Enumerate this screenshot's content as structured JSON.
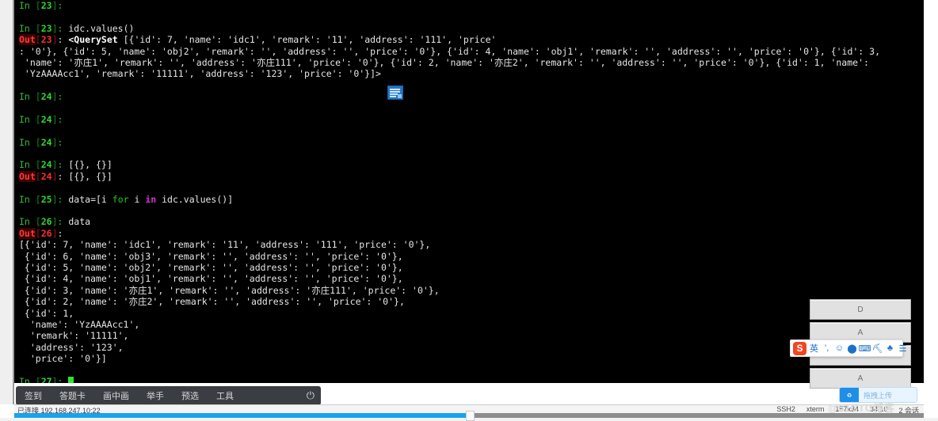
{
  "terminal": {
    "lines": [
      {
        "type": "prompt_only",
        "label": "In",
        "num": "23",
        "code": ""
      },
      {
        "type": "blank"
      },
      {
        "type": "input",
        "label": "In",
        "num": "23",
        "code": "idc.values()"
      },
      {
        "type": "output_head",
        "label": "Out",
        "num": "23",
        "code": "<QuerySet [{'id': 7, 'name': 'idc1', 'remark': '11', 'address': '111', 'price'"
      },
      {
        "type": "plain",
        "code": ": '0'}, {'id': 5, 'name': 'obj2', 'remark': '', 'address': '', 'price': '0'}, {'id': 4, 'name': 'obj1', 'remark': '', 'address': '', 'price': '0'}, {'id': 3,"
      },
      {
        "type": "plain",
        "code": " 'name': '亦庄1', 'remark': '', 'address': '亦庄111', 'price': '0'}, {'id': 2, 'name': '亦庄2', 'remark': '', 'address': '', 'price': '0'}, {'id': 1, 'name':"
      },
      {
        "type": "plain",
        "code": " 'YzAAAAcc1', 'remark': '11111', 'address': '123', 'price': '0'}]>"
      },
      {
        "type": "blank"
      },
      {
        "type": "input",
        "label": "In",
        "num": "24",
        "code": ""
      },
      {
        "type": "blank"
      },
      {
        "type": "input",
        "label": "In",
        "num": "24",
        "code": ""
      },
      {
        "type": "blank"
      },
      {
        "type": "input",
        "label": "In",
        "num": "24",
        "code": ""
      },
      {
        "type": "blank"
      },
      {
        "type": "input",
        "label": "In",
        "num": "24",
        "code": "[{}, {}]"
      },
      {
        "type": "output",
        "label": "Out",
        "num": "24",
        "code": "[{}, {}]"
      },
      {
        "type": "blank"
      },
      {
        "type": "input_kw",
        "label": "In",
        "num": "25",
        "code": "data=[i for i in idc.values()]"
      },
      {
        "type": "blank"
      },
      {
        "type": "input",
        "label": "In",
        "num": "26",
        "code": "data"
      },
      {
        "type": "output_only",
        "label": "Out",
        "num": "26",
        "code": ""
      },
      {
        "type": "plain",
        "code": "[{'id': 7, 'name': 'idc1', 'remark': '11', 'address': '111', 'price': '0'},"
      },
      {
        "type": "plain",
        "code": " {'id': 6, 'name': 'obj3', 'remark': '', 'address': '', 'price': '0'},"
      },
      {
        "type": "plain",
        "code": " {'id': 5, 'name': 'obj2', 'remark': '', 'address': '', 'price': '0'},"
      },
      {
        "type": "plain",
        "code": " {'id': 4, 'name': 'obj1', 'remark': '', 'address': '', 'price': '0'},"
      },
      {
        "type": "plain",
        "code": " {'id': 3, 'name': '亦庄1', 'remark': '', 'address': '亦庄111', 'price': '0'},"
      },
      {
        "type": "plain",
        "code": " {'id': 2, 'name': '亦庄2', 'remark': '', 'address': '', 'price': '0'},"
      },
      {
        "type": "plain",
        "code": " {'id': 1,"
      },
      {
        "type": "plain",
        "code": "  'name': 'YzAAAAcc1',"
      },
      {
        "type": "plain",
        "code": "  'remark': '11111',"
      },
      {
        "type": "plain",
        "code": "  'address': '123',"
      },
      {
        "type": "plain",
        "code": "  'price': '0'}]"
      },
      {
        "type": "blank"
      },
      {
        "type": "cursor",
        "label": "In",
        "num": "27",
        "code": ""
      }
    ],
    "syntax_keywords": [
      "for",
      "in"
    ],
    "colors": {
      "background": "#000000",
      "in_prompt": "#2fd72f",
      "out_prompt": "#ff2d2d",
      "text": "#dcdcdc",
      "keyword_for": "#1ecb1e",
      "keyword_in": "#d42fd4"
    }
  },
  "clipboard_icon": {
    "name": "clipboard-paste-icon"
  },
  "side_buttons": [
    {
      "label": "D",
      "name": "side-button-d"
    },
    {
      "label": "A",
      "name": "side-button-a-1"
    },
    {
      "label": "A",
      "name": "side-button-a-2"
    },
    {
      "label": "A",
      "name": "side-button-a-3"
    }
  ],
  "ime_bar": {
    "logo": "S",
    "items": [
      {
        "glyph": "英",
        "name": "ime-language-toggle"
      },
      {
        "glyph": "’,",
        "name": "ime-punctuation-icon"
      },
      {
        "glyph": "☺",
        "name": "ime-emoji-icon"
      },
      {
        "glyph": "⬤",
        "name": "ime-voice-icon"
      },
      {
        "glyph": "⌨",
        "name": "ime-keyboard-icon"
      },
      {
        "glyph": "⛏",
        "name": "ime-toolbox-icon"
      },
      {
        "glyph": "♣",
        "name": "ime-skin-icon"
      },
      {
        "glyph": "☰",
        "name": "ime-menu-icon"
      }
    ]
  },
  "class_toolbar": {
    "items": [
      {
        "label": "签到",
        "name": "toolbar-signin"
      },
      {
        "label": "答题卡",
        "name": "toolbar-answer-card"
      },
      {
        "label": "画中画",
        "name": "toolbar-pip"
      },
      {
        "label": "举手",
        "name": "toolbar-raise-hand"
      },
      {
        "label": "预选",
        "name": "toolbar-preselect"
      },
      {
        "label": "工具",
        "name": "toolbar-tools"
      }
    ],
    "power": "⏻"
  },
  "status_bar": {
    "connection": "已连接 192.168.247.10:22",
    "protocol": "SSH2",
    "term_type": "xterm",
    "size": "157x34",
    "cursor": "34,10",
    "sessions": "2 会话"
  },
  "upload_chip": {
    "icon": "♻",
    "label": "拖拽上传"
  },
  "watermark": "@51CTO博客",
  "scrollbar": {
    "fill_percent": 50,
    "knob_left_percent": 50
  }
}
